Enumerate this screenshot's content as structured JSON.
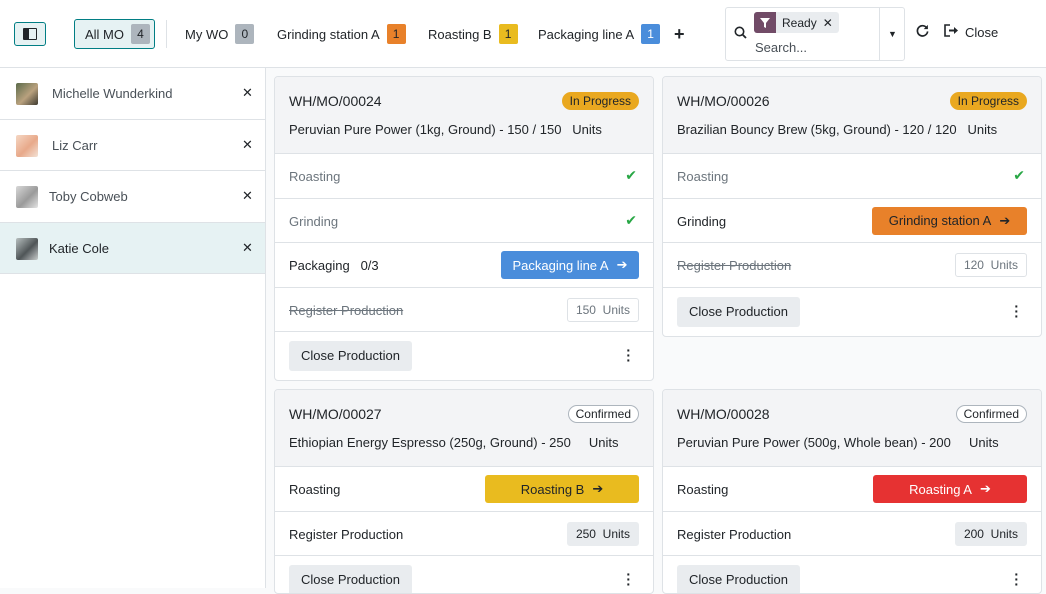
{
  "toolbar": {
    "tabs": [
      {
        "label": "All MO",
        "count": "4",
        "count_color": "gray"
      },
      {
        "label": "My WO",
        "count": "0",
        "count_color": "gray"
      },
      {
        "label": "Grinding station A",
        "count": "1",
        "count_color": "orange"
      },
      {
        "label": "Roasting B",
        "count": "1",
        "count_color": "yellow"
      },
      {
        "label": "Packaging line A",
        "count": "1",
        "count_color": "blue"
      }
    ],
    "search": {
      "facet": "Ready",
      "placeholder": "Search..."
    },
    "close_label": "Close"
  },
  "employees": [
    {
      "name": "Michelle Wunderkind",
      "selected": false
    },
    {
      "name": "Liz Carr",
      "selected": false
    },
    {
      "name": "Toby Cobweb",
      "selected": false
    },
    {
      "name": "Katie Cole",
      "selected": true
    }
  ],
  "cards": [
    {
      "ref": "WH/MO/00024",
      "state": "In Progress",
      "product": "Peruvian Pure Power (1kg, Ground) - 150 / 150",
      "uom": "Units",
      "ops": [
        {
          "label": "Roasting",
          "done": true
        },
        {
          "label": "Grinding",
          "done": true
        },
        {
          "label": "Packaging",
          "progress": "0/3",
          "button": "Packaging line A",
          "color": "#4a8ddb"
        }
      ],
      "register": {
        "label": "Register Production",
        "qty": "150",
        "uom": "Units",
        "strike": true
      },
      "close": "Close Production"
    },
    {
      "ref": "WH/MO/00026",
      "state": "In Progress",
      "product": "Brazilian Bouncy Brew (5kg, Ground) - 120 / 120",
      "uom": "Units",
      "ops": [
        {
          "label": "Roasting",
          "done": true
        },
        {
          "label": "Grinding",
          "button": "Grinding station A",
          "color": "#e8812a"
        }
      ],
      "register": {
        "label": "Register Production",
        "qty": "120",
        "uom": "Units",
        "strike": true
      },
      "close": "Close Production"
    },
    {
      "ref": "WH/MO/00027",
      "state": "Confirmed",
      "product": "Ethiopian Energy Espresso (250g, Ground) - 250",
      "uom": "Units",
      "ops": [
        {
          "label": "Roasting",
          "button": "Roasting B",
          "color": "#e9bb1f"
        }
      ],
      "register": {
        "label": "Register Production",
        "qty": "250",
        "uom": "Units",
        "strike": false
      },
      "close": "Close Production"
    },
    {
      "ref": "WH/MO/00028",
      "state": "Confirmed",
      "product": "Peruvian Pure Power (500g, Whole bean) - 200",
      "uom": "Units",
      "ops": [
        {
          "label": "Roasting",
          "button": "Roasting A",
          "color": "#e63232"
        }
      ],
      "register": {
        "label": "Register Production",
        "qty": "200",
        "uom": "Units",
        "strike": false
      },
      "close": "Close Production"
    }
  ]
}
